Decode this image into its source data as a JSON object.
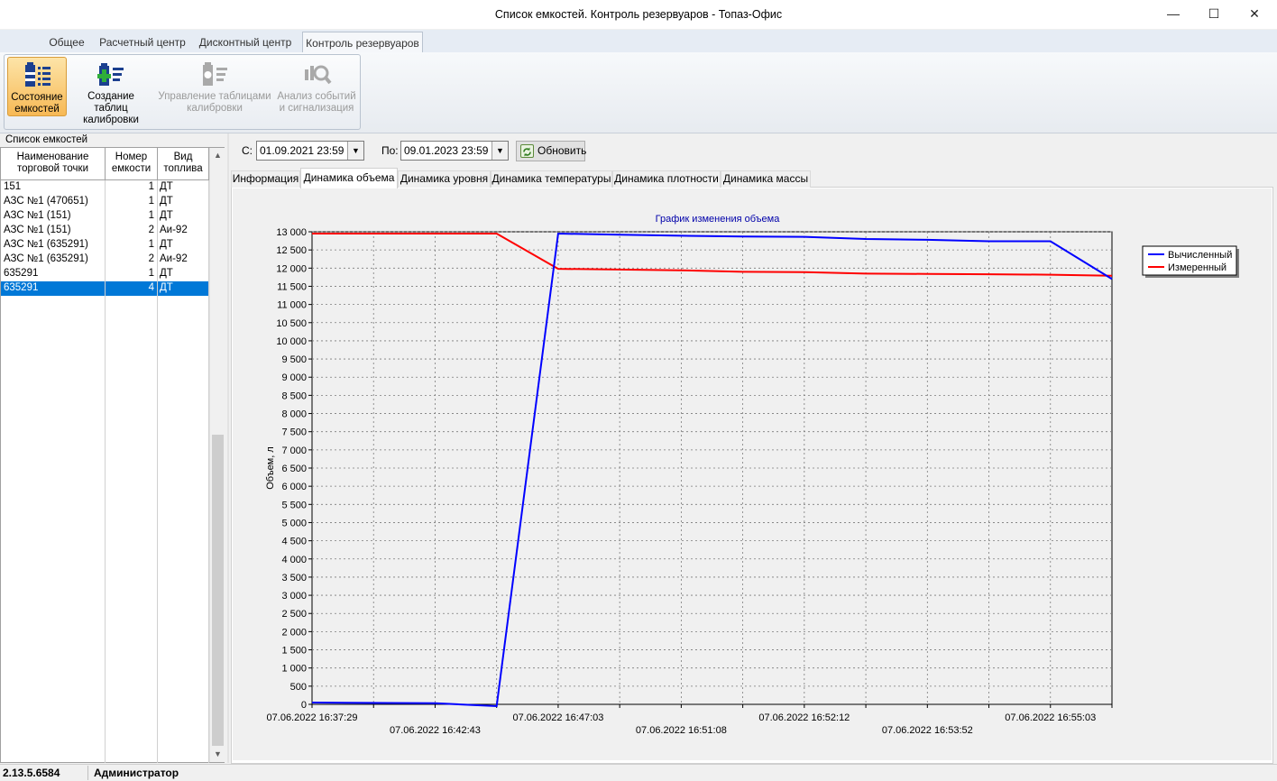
{
  "window": {
    "title": "Список емкостей. Контроль резервуаров - Топаз-Офис",
    "controls": [
      "—",
      "☐",
      "✕"
    ]
  },
  "ribbon": {
    "tabs": [
      "Общее",
      "Расчетный центр",
      "Дисконтный центр",
      "Контроль резервуаров"
    ],
    "active_tab": 3,
    "buttons": [
      {
        "label1": "Состояние",
        "label2": "емкостей",
        "icon": "tank-state-icon",
        "state": "active"
      },
      {
        "label1": "Создание таблиц",
        "label2": "калибровки",
        "icon": "create-calibration-icon",
        "state": "enabled"
      },
      {
        "label1": "Управление таблицами",
        "label2": "калибровки",
        "icon": "manage-calibration-icon",
        "state": "disabled"
      },
      {
        "label1": "Анализ событий",
        "label2": "и сигнализация",
        "icon": "event-analysis-icon",
        "state": "disabled"
      }
    ]
  },
  "tank_list": {
    "caption": "Список емкостей",
    "columns": [
      {
        "l1": "Наименование",
        "l2": "торговой точки"
      },
      {
        "l1": "Номер",
        "l2": "емкости"
      },
      {
        "l1": "Вид",
        "l2": "топлива"
      }
    ],
    "rows": [
      {
        "point": "151",
        "tank": "1",
        "fuel": "ДТ"
      },
      {
        "point": "АЗС №1 (470651)",
        "tank": "1",
        "fuel": "ДТ"
      },
      {
        "point": "АЗС №1 (151)",
        "tank": "1",
        "fuel": "ДТ"
      },
      {
        "point": "АЗС №1 (151)",
        "tank": "2",
        "fuel": "Аи-92"
      },
      {
        "point": "АЗС №1 (635291)",
        "tank": "1",
        "fuel": "ДТ"
      },
      {
        "point": "АЗС №1 (635291)",
        "tank": "2",
        "fuel": "Аи-92"
      },
      {
        "point": "635291",
        "tank": "1",
        "fuel": "ДТ"
      },
      {
        "point": "635291",
        "tank": "4",
        "fuel": "ДТ"
      }
    ],
    "selected_row": 7
  },
  "filter": {
    "from_label": "С:",
    "from_value": "01.09.2021 23:59",
    "to_label": "По:",
    "to_value": "09.01.2023 23:59",
    "refresh_label": "Обновить"
  },
  "content_tabs": [
    "Информация",
    "Динамика объема",
    "Динамика уровня",
    "Динамика температуры",
    "Динамика плотности",
    "Динамика массы"
  ],
  "active_content_tab": 1,
  "chart_data": {
    "type": "line",
    "title": "График изменения объема",
    "xlabel": "",
    "ylabel": "Объем, л",
    "ylim": [
      0,
      13000
    ],
    "y_ticks": [
      "0",
      "500",
      "1 000",
      "1 500",
      "2 000",
      "2 500",
      "3 000",
      "3 500",
      "4 000",
      "4 500",
      "5 000",
      "5 500",
      "6 000",
      "6 500",
      "7 000",
      "7 500",
      "8 000",
      "8 500",
      "9 000",
      "9 500",
      "10 000",
      "10 500",
      "11 000",
      "11 500",
      "12 000",
      "12 500",
      "13 000"
    ],
    "x_categories": [
      "07.06.2022 16:37:29",
      "",
      "07.06.2022 16:42:43",
      "",
      "07.06.2022 16:47:03",
      "",
      "07.06.2022 16:51:08",
      "",
      "07.06.2022 16:52:12",
      "",
      "07.06.2022 16:53:52",
      "",
      "07.06.2022 16:55:03",
      ""
    ],
    "grid": true,
    "legend_position": "right",
    "series": [
      {
        "name": "Вычисленный",
        "color": "#0000ff",
        "points": [
          [
            0,
            50
          ],
          [
            2,
            30
          ],
          [
            3,
            -50
          ],
          [
            4,
            12950
          ],
          [
            5,
            12920
          ],
          [
            6,
            12890
          ],
          [
            7,
            12870
          ],
          [
            8,
            12860
          ],
          [
            9,
            12800
          ],
          [
            10,
            12780
          ],
          [
            11,
            12740
          ],
          [
            12,
            12740
          ],
          [
            13,
            11700
          ]
        ]
      },
      {
        "name": "Измеренный",
        "color": "#ff0000",
        "points": [
          [
            0,
            12950
          ],
          [
            2,
            12950
          ],
          [
            3,
            12950
          ],
          [
            4,
            11980
          ],
          [
            5,
            11960
          ],
          [
            6,
            11940
          ],
          [
            7,
            11900
          ],
          [
            8,
            11890
          ],
          [
            9,
            11850
          ],
          [
            10,
            11840
          ],
          [
            11,
            11830
          ],
          [
            12,
            11820
          ],
          [
            13,
            11790
          ]
        ]
      }
    ]
  },
  "status": {
    "version": "2.13.5.6584",
    "user": "Администратор"
  }
}
